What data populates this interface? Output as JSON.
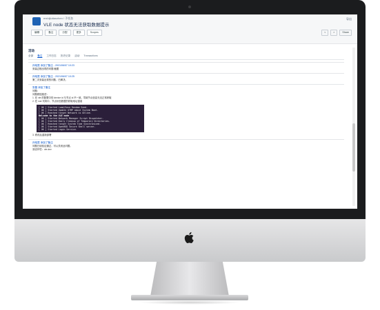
{
  "issue": {
    "project": "ershijiutianzhen / 子任务",
    "title": "VLE node 状态无法获取数据提示",
    "toolbar": [
      "编辑",
      "备注",
      "分配",
      "更多",
      "Scopes"
    ],
    "export_label": "导出",
    "right_toolbar": [
      "<",
      ">",
      "Share"
    ]
  },
  "activity": {
    "heading": "活动",
    "tabs": [
      "全部",
      "备注",
      "工作日志",
      "历史记录",
      "活动",
      "Transactions"
    ],
    "active_tab": "备注",
    "comments": [
      {
        "author": "孙晓雯 添加了备注 - 2021/06/07 10:23",
        "lines": [
          "安装过程出现的问题 截图"
        ]
      },
      {
        "author": "孙晓雯 添加了备注 - 2021/06/07 10:25",
        "lines": [
          "第二次安装出现的问题，已解决。"
        ]
      },
      {
        "author": "张磊 添加了备注",
        "lines": [
          "问题：",
          "问题原因描述：",
          "1. 在 vle 的配置中的 device id 与节点 id 不一致，导致节点信息无法正常获取",
          "2. 在 vue 代码中，节点状态数据的获取地址错误",
          "3. 修改后重新部署"
        ]
      },
      {
        "author": "孙晓雯 添加了备注",
        "lines": [
          "问题已经验证通过，可以关闭此问题。",
          "测试环境：vle.dev"
        ]
      }
    ],
    "console": [
      "[ OK ] Started Load/Save Random Seed.",
      "[ OK ] Started Update UTMP about System Boot.",
      "[ OK ] Reached target Network is Online.",
      "Welcome to the VLE node",
      "[ OK ] Started Network Manager Script Dispatcher.",
      "[ OK ] Started Daily Cleanup of Temporary Directories.",
      "[ OK ] Reached target System Time Synchronized.",
      "[ OK ] Started OpenBSD Secure Shell server.",
      "[ OK ] Started Login Service."
    ],
    "console_highlight_rows": [
      3
    ]
  }
}
